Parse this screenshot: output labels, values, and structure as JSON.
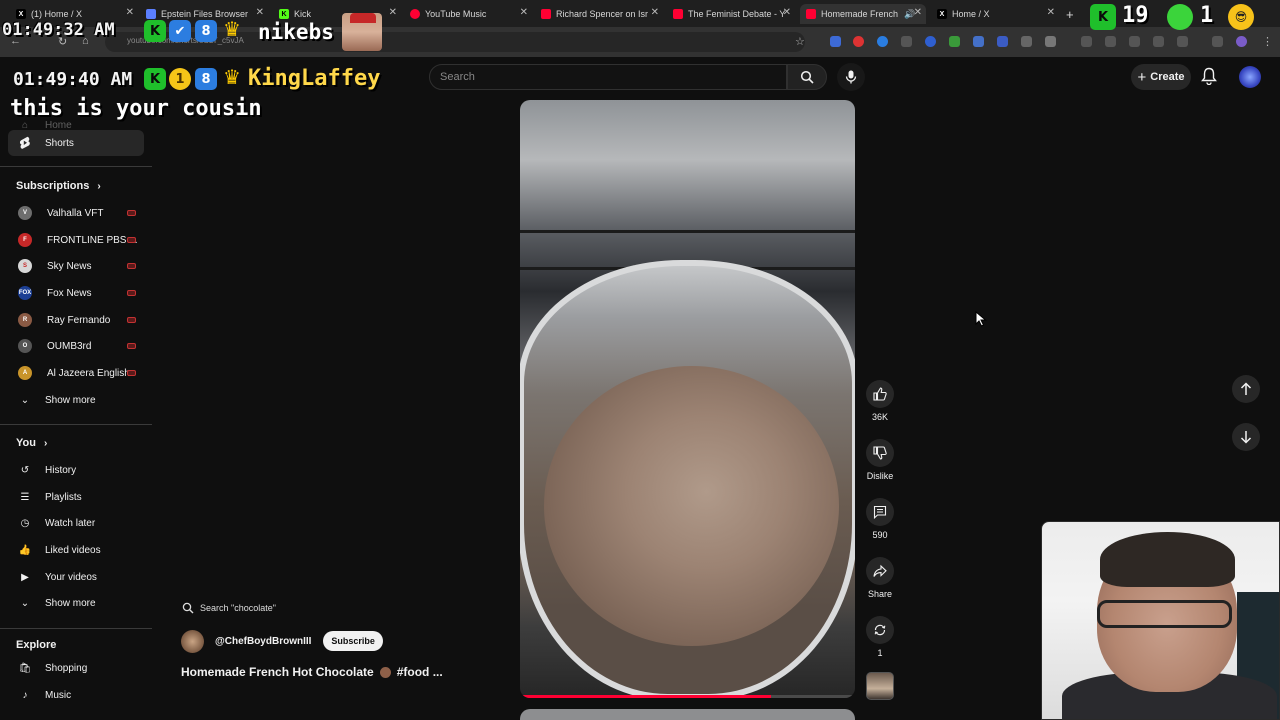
{
  "browser": {
    "tabs": [
      {
        "label": "(1) Home / X",
        "icon": "x-icon",
        "color": "#000000"
      },
      {
        "label": "Epstein Files Browser",
        "icon": "doc-icon",
        "color": "#5b7fff"
      },
      {
        "label": "Kick",
        "icon": "kick-icon",
        "color": "#53fc18"
      },
      {
        "label": "YouTube Music",
        "icon": "ytmusic-icon",
        "color": "#ff0033"
      },
      {
        "label": "Richard Spencer on Isr",
        "icon": "youtube-icon",
        "color": "#ff0033"
      },
      {
        "label": "The Feminist Debate - Y",
        "icon": "youtube-icon",
        "color": "#ff0033"
      },
      {
        "label": "Homemade French",
        "icon": "youtube-icon",
        "color": "#ff0033",
        "active": true
      },
      {
        "label": "Home / X",
        "icon": "x-icon",
        "color": "#000000"
      }
    ],
    "url": "youtube.com/shorts/eSLT_c5vJA"
  },
  "overlay": {
    "clock_top": "01:49:32 AM",
    "chatter_top": "nikebs",
    "clock_main": "01:49:40 AM",
    "badge_one": "1",
    "chatter_main": "KingLaffey",
    "message": "this is your cousin",
    "kick_count": "19",
    "kick_count_2": "1"
  },
  "masthead": {
    "search_placeholder": "Search",
    "create_label": "Create"
  },
  "sidebar": {
    "home_label": "Home",
    "shorts_label": "Shorts",
    "subscriptions_heading": "Subscriptions",
    "subscriptions": [
      {
        "name": "Valhalla VFT",
        "color": "#6e6e6e",
        "initials": "V"
      },
      {
        "name": "FRONTLINE PBS ...",
        "color": "#c62828",
        "initials": "F"
      },
      {
        "name": "Sky News",
        "color": "#d7d7d7",
        "initials": "S"
      },
      {
        "name": "Fox News",
        "color": "#1c3f94",
        "initials": "FOX"
      },
      {
        "name": "Ray Fernando",
        "color": "#8a5a44",
        "initials": "R"
      },
      {
        "name": "OUMB3rd",
        "color": "#555555",
        "initials": "O"
      },
      {
        "name": "Al Jazeera English",
        "color": "#c8942a",
        "initials": "A"
      }
    ],
    "show_more_subs": "Show more",
    "you_heading": "You",
    "you_items": [
      {
        "label": "History",
        "icon": "history-icon"
      },
      {
        "label": "Playlists",
        "icon": "playlists-icon"
      },
      {
        "label": "Watch later",
        "icon": "watch-later-icon"
      },
      {
        "label": "Liked videos",
        "icon": "liked-icon"
      },
      {
        "label": "Your videos",
        "icon": "your-videos-icon"
      }
    ],
    "show_more_you": "Show more",
    "explore_heading": "Explore",
    "explore_items": [
      {
        "label": "Shopping",
        "icon": "shopping-icon"
      },
      {
        "label": "Music",
        "icon": "music-icon"
      }
    ]
  },
  "short": {
    "search_chip": "Search \"chocolate\"",
    "channel": "@ChefBoydBrownIII",
    "subscribe_label": "Subscribe",
    "title_part1": "Homemade French Hot Chocolate",
    "title_part2": "#food ...",
    "progress": 0.75,
    "likes": "36K",
    "dislike_label": "Dislike",
    "comments": "590",
    "share_label": "Share",
    "remix_count": "1"
  }
}
